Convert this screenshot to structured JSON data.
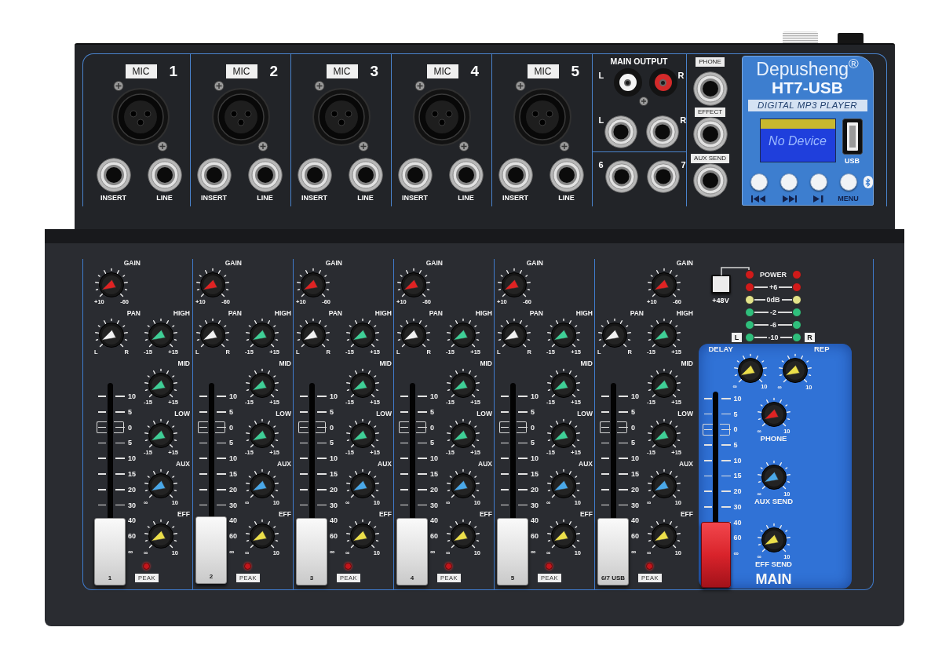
{
  "inputs": [
    {
      "label": "MIC",
      "number": "1",
      "jacks": [
        "INSERT",
        "LINE"
      ]
    },
    {
      "label": "MIC",
      "number": "2",
      "jacks": [
        "INSERT",
        "LINE"
      ]
    },
    {
      "label": "MIC",
      "number": "3",
      "jacks": [
        "INSERT",
        "LINE"
      ]
    },
    {
      "label": "MIC",
      "number": "4",
      "jacks": [
        "INSERT",
        "LINE"
      ]
    },
    {
      "label": "MIC",
      "number": "5",
      "jacks": [
        "INSERT",
        "LINE"
      ]
    }
  ],
  "main_output": {
    "title": "MAIN OUTPUT",
    "rca_jacks": [
      {
        "label": "L",
        "color": "#f4f4f4"
      },
      {
        "label": "R",
        "color": "#d42a2a"
      }
    ],
    "jacks": [
      "L",
      "R"
    ],
    "stereo_inputs": [
      "6",
      "7"
    ]
  },
  "sends": [
    "PHONE",
    "EFFECT",
    "AUX SEND"
  ],
  "mp3_player": {
    "brand": "Depusheng$^{®}$",
    "model": "HT7-USB",
    "subtitle": "DIGITAL MP3 PLAYER",
    "display": "No Device",
    "usb_label": "USB",
    "buttons": [
      {
        "kind": "previous"
      },
      {
        "kind": "next"
      },
      {
        "kind": "play_pause"
      },
      {
        "kind": "menu",
        "label": "MENU"
      }
    ]
  },
  "channels": [
    {
      "kind": "mono",
      "knobs": [
        {
          "kind": "gain",
          "label": "GAIN",
          "min": "+10",
          "max": "-60"
        },
        {
          "kind": "pan",
          "label": "PAN",
          "min": "L",
          "max": "R"
        },
        {
          "kind": "eq",
          "label": "HIGH",
          "min": "-15",
          "max": "+15"
        },
        {
          "kind": "eq",
          "label": "MID",
          "min": "-15",
          "max": "+15"
        },
        {
          "kind": "eq",
          "label": "LOW",
          "min": "-15",
          "max": "+15"
        },
        {
          "kind": "aux",
          "label": "AUX",
          "min": "∞",
          "max": "10"
        },
        {
          "kind": "eff",
          "label": "EFF",
          "min": "∞",
          "max": "10"
        }
      ],
      "fader": {
        "scale": [
          "10",
          "5",
          "0",
          "5",
          "10",
          "15",
          "20",
          "30",
          "40",
          "60",
          "∞"
        ],
        "cap_label": "1",
        "level": 0.17
      },
      "peak_label": "PEAK"
    },
    {
      "kind": "mono",
      "knobs": [
        {
          "kind": "gain",
          "label": "GAIN",
          "min": "+10",
          "max": "-60"
        },
        {
          "kind": "pan",
          "label": "PAN",
          "min": "L",
          "max": "R"
        },
        {
          "kind": "eq",
          "label": "HIGH",
          "min": "-15",
          "max": "+15"
        },
        {
          "kind": "eq",
          "label": "MID",
          "min": "-15",
          "max": "+15"
        },
        {
          "kind": "eq",
          "label": "LOW",
          "min": "-15",
          "max": "+15"
        },
        {
          "kind": "aux",
          "label": "AUX",
          "min": "∞",
          "max": "10"
        },
        {
          "kind": "eff",
          "label": "EFF",
          "min": "∞",
          "max": "10"
        }
      ],
      "fader": {
        "scale": [
          "10",
          "5",
          "0",
          "5",
          "10",
          "15",
          "20",
          "30",
          "40",
          "60",
          "∞"
        ],
        "cap_label": "2",
        "level": 0.18
      },
      "peak_label": "PEAK"
    },
    {
      "kind": "mono",
      "knobs": [
        {
          "kind": "gain",
          "label": "GAIN",
          "min": "+10",
          "max": "-60"
        },
        {
          "kind": "pan",
          "label": "PAN",
          "min": "L",
          "max": "R"
        },
        {
          "kind": "eq",
          "label": "HIGH",
          "min": "-15",
          "max": "+15"
        },
        {
          "kind": "eq",
          "label": "MID",
          "min": "-15",
          "max": "+15"
        },
        {
          "kind": "eq",
          "label": "LOW",
          "min": "-15",
          "max": "+15"
        },
        {
          "kind": "aux",
          "label": "AUX",
          "min": "∞",
          "max": "10"
        },
        {
          "kind": "eff",
          "label": "EFF",
          "min": "∞",
          "max": "10"
        }
      ],
      "fader": {
        "scale": [
          "10",
          "5",
          "0",
          "5",
          "10",
          "15",
          "20",
          "30",
          "40",
          "60",
          "∞"
        ],
        "cap_label": "3",
        "level": 0.17
      },
      "peak_label": "PEAK"
    },
    {
      "kind": "mono",
      "knobs": [
        {
          "kind": "gain",
          "label": "GAIN",
          "min": "+10",
          "max": "-60"
        },
        {
          "kind": "pan",
          "label": "PAN",
          "min": "L",
          "max": "R"
        },
        {
          "kind": "eq",
          "label": "HIGH",
          "min": "-15",
          "max": "+15"
        },
        {
          "kind": "eq",
          "label": "MID",
          "min": "-15",
          "max": "+15"
        },
        {
          "kind": "eq",
          "label": "LOW",
          "min": "-15",
          "max": "+15"
        },
        {
          "kind": "aux",
          "label": "AUX",
          "min": "∞",
          "max": "10"
        },
        {
          "kind": "eff",
          "label": "EFF",
          "min": "∞",
          "max": "10"
        }
      ],
      "fader": {
        "scale": [
          "10",
          "5",
          "0",
          "5",
          "10",
          "15",
          "20",
          "30",
          "40",
          "60",
          "∞"
        ],
        "cap_label": "4",
        "level": 0.17
      },
      "peak_label": "PEAK"
    },
    {
      "kind": "mono",
      "knobs": [
        {
          "kind": "gain",
          "label": "GAIN",
          "min": "+10",
          "max": "-60"
        },
        {
          "kind": "pan",
          "label": "PAN",
          "min": "L",
          "max": "R"
        },
        {
          "kind": "eq",
          "label": "HIGH",
          "min": "-15",
          "max": "+15"
        },
        {
          "kind": "eq",
          "label": "MID",
          "min": "-15",
          "max": "+15"
        },
        {
          "kind": "eq",
          "label": "LOW",
          "min": "-15",
          "max": "+15"
        },
        {
          "kind": "aux",
          "label": "AUX",
          "min": "∞",
          "max": "10"
        },
        {
          "kind": "eff",
          "label": "EFF",
          "min": "∞",
          "max": "10"
        }
      ],
      "fader": {
        "scale": [
          "10",
          "5",
          "0",
          "5",
          "10",
          "15",
          "20",
          "30",
          "40",
          "60",
          "∞"
        ],
        "cap_label": "5",
        "level": 0.17
      },
      "peak_label": "PEAK"
    },
    {
      "kind": "stereo",
      "knobs": [
        {
          "kind": "gain",
          "label": "GAIN",
          "min": "+10",
          "max": "-60"
        },
        {
          "kind": "pan",
          "label": "PAN",
          "min": "L",
          "max": "R"
        },
        {
          "kind": "eq",
          "label": "HIGH",
          "min": "-15",
          "max": "+15"
        },
        {
          "kind": "eq",
          "label": "MID",
          "min": "-15",
          "max": "+15"
        },
        {
          "kind": "eq",
          "label": "LOW",
          "min": "-15",
          "max": "+15"
        },
        {
          "kind": "aux",
          "label": "AUX",
          "min": "∞",
          "max": "10"
        },
        {
          "kind": "eff",
          "label": "EFF",
          "min": "∞",
          "max": "10"
        }
      ],
      "fader": {
        "scale": [
          "10",
          "5",
          "0",
          "5",
          "10",
          "15",
          "20",
          "30",
          "40",
          "60",
          "∞"
        ],
        "cap_label": "6/7 USB",
        "level": 0.17
      },
      "peak_label": "PEAK"
    }
  ],
  "master": {
    "phantom_label": "+48V",
    "meter": {
      "rows": [
        {
          "kind": "power",
          "label": "POWER",
          "color": "#d11a1a"
        },
        {
          "kind": "level",
          "label": "+6",
          "color": "#d11a1a"
        },
        {
          "kind": "level",
          "label": "0dB",
          "color": "#e3e48a"
        },
        {
          "kind": "level",
          "label": "-2",
          "color": "#2fbe7c"
        },
        {
          "kind": "level",
          "label": "-6",
          "color": "#2fbe7c"
        },
        {
          "kind": "level",
          "label": "-10",
          "color": "#2fbe7c"
        }
      ],
      "left_label": "L",
      "right_label": "R"
    },
    "knobs": [
      {
        "kind": "delay",
        "label": "DELAY",
        "min": "∞",
        "max": "10"
      },
      {
        "kind": "rep",
        "label": "REP",
        "min": "∞",
        "max": "10"
      },
      {
        "kind": "phone",
        "label": "PHONE",
        "min": "∞",
        "max": "10"
      },
      {
        "kind": "aux_send",
        "label": "AUX SEND",
        "min": "∞",
        "max": "10"
      },
      {
        "kind": "eff_send",
        "label": "EFF SEND",
        "min": "∞",
        "max": "10"
      }
    ],
    "fader": {
      "scale": [
        "10",
        "5",
        "0",
        "5",
        "10",
        "15",
        "20",
        "30",
        "40",
        "60",
        "∞"
      ],
      "level": 0.17
    },
    "title": "MAIN"
  }
}
